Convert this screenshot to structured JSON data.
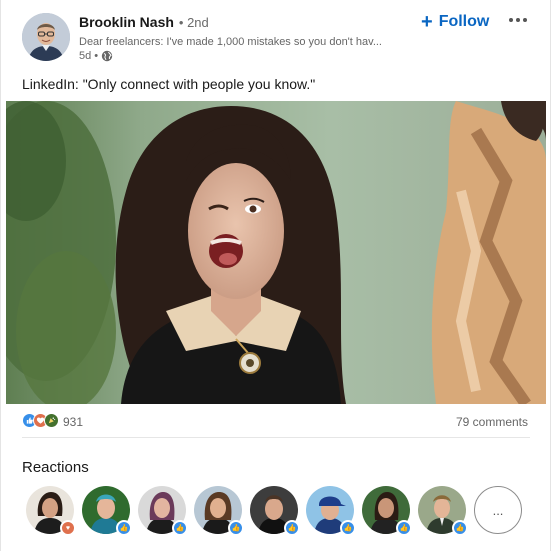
{
  "post": {
    "author": "Brooklin Nash",
    "degree": "• 2nd",
    "headline": "Dear freelancers: I've made 1,000 mistakes so you don't hav...",
    "age": "5d •",
    "visibility_icon": "globe-icon",
    "follow_label": "Follow",
    "follow_icon": "plus-icon",
    "more_icon": "ellipsis-icon",
    "text": "LinkedIn: \"Only connect with people you know.\"",
    "media": "photo"
  },
  "social": {
    "reaction_types": [
      "like",
      "love",
      "celebrate"
    ],
    "reaction_count": "931",
    "comments": "79 comments"
  },
  "reactions": {
    "title": "Reactions",
    "people": [
      {
        "badge": "love"
      },
      {
        "badge": "like"
      },
      {
        "badge": "like"
      },
      {
        "badge": "like"
      },
      {
        "badge": "like"
      },
      {
        "badge": "like"
      },
      {
        "badge": "like"
      },
      {
        "badge": "like"
      }
    ],
    "more_label": "..."
  },
  "colors": {
    "accent": "#0a66c2",
    "like": "#378fe9",
    "love": "#df704d",
    "celebrate": "#44712e"
  }
}
